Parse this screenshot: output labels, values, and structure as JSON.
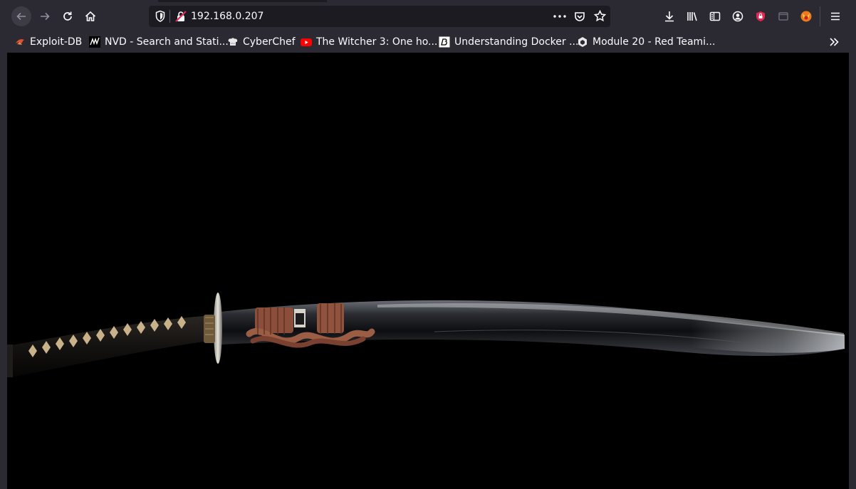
{
  "browser": {
    "url": "192.168.0.207"
  },
  "bookmarks": [
    {
      "label": "Exploit-DB",
      "icon": "exploit-db-icon"
    },
    {
      "label": "NVD - Search and Stati...",
      "icon": "nvd-icon"
    },
    {
      "label": "CyberChef",
      "icon": "cyberchef-icon"
    },
    {
      "label": "The Witcher 3: One ho...",
      "icon": "youtube-icon"
    },
    {
      "label": "Understanding Docker ...",
      "icon": "docker-article-icon"
    },
    {
      "label": "Module 20 - Red Teami...",
      "icon": "module-icon"
    }
  ],
  "page": {
    "image_alt": "",
    "background": "#000000"
  },
  "colors": {
    "chrome": "#2b2a33",
    "urlbar": "#1c1b22",
    "text": "#fbfbfe",
    "accent_red": "#e22850"
  }
}
